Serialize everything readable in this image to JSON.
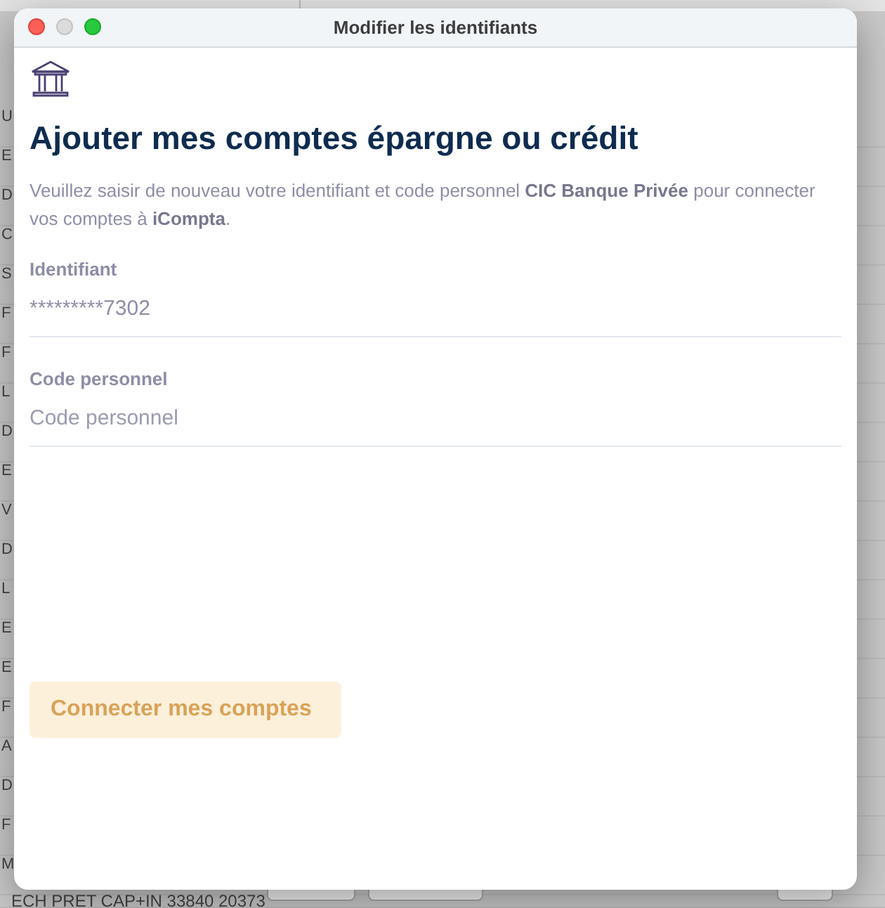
{
  "background_window": {
    "rows": [
      "U",
      "E",
      "D",
      "C",
      "S",
      "F",
      "F",
      "L",
      "D",
      "E",
      "V",
      "D",
      "L",
      "E",
      "E",
      "F",
      "A",
      "D",
      "F",
      "M",
      "ECH PRET CAP+IN 33840 20373"
    ]
  },
  "window": {
    "title": "Modifier les identifiants",
    "controls": [
      {
        "kind": "close",
        "disabled": false
      },
      {
        "kind": "minimize",
        "disabled": true
      },
      {
        "kind": "zoom",
        "disabled": false
      }
    ]
  },
  "heading": "Ajouter mes comptes épargne ou crédit",
  "description": "Veuillez saisir de nouveau votre identifiant et code personnel **CIC Banque Privée** pour connecter vos comptes à **iCompta**.",
  "fields": [
    {
      "label": "Identifiant",
      "value": "*********7302"
    },
    {
      "label": "Code personnel",
      "placeholder": "Code personnel"
    }
  ],
  "submit": {
    "label": "Connecter mes comptes",
    "disabled": true
  }
}
